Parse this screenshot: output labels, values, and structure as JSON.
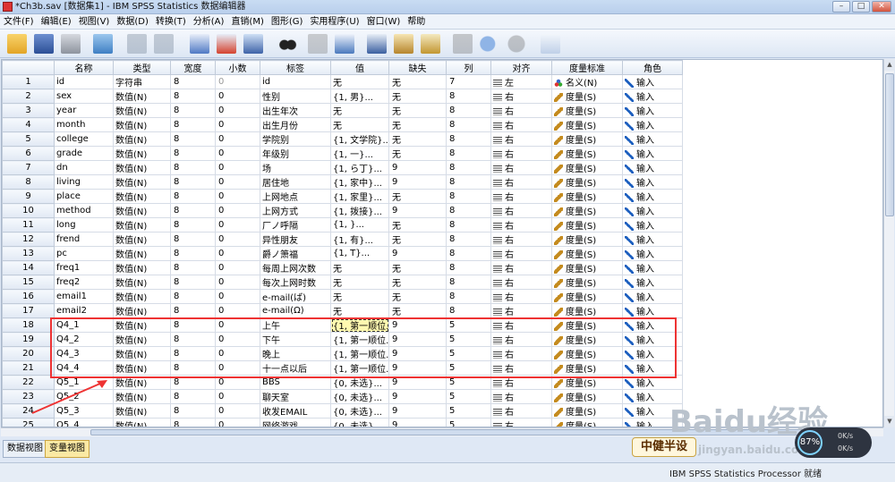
{
  "window": {
    "title": "*Ch3b.sav [数据集1] - IBM SPSS Statistics 数据编辑器"
  },
  "menu": [
    "文件(F)",
    "编辑(E)",
    "视图(V)",
    "数据(D)",
    "转换(T)",
    "分析(A)",
    "直销(M)",
    "图形(G)",
    "实用程序(U)",
    "窗口(W)",
    "帮助"
  ],
  "toolbar": [
    {
      "icon": "open-folder-icon"
    },
    {
      "icon": "save-icon"
    },
    {
      "icon": "print-icon"
    },
    {
      "icon": "dialog-recall-icon"
    },
    {
      "icon": "undo-icon"
    },
    {
      "icon": "redo-icon"
    },
    {
      "icon": "goto-case-icon"
    },
    {
      "icon": "goto-variable-icon"
    },
    {
      "icon": "variables-icon"
    },
    {
      "icon": "find-icon"
    },
    {
      "icon": "insert-cases-icon"
    },
    {
      "icon": "insert-variable-icon"
    },
    {
      "icon": "split-file-icon"
    },
    {
      "icon": "weight-cases-icon"
    },
    {
      "icon": "select-cases-icon"
    },
    {
      "icon": "value-labels-icon"
    },
    {
      "icon": "use-sets-icon"
    },
    {
      "icon": "show-all-variables-icon"
    },
    {
      "icon": "spell-check-icon"
    }
  ],
  "columns": [
    "名称",
    "类型",
    "宽度",
    "小数",
    "标签",
    "值",
    "缺失",
    "列",
    "对齐",
    "度量标准",
    "角色"
  ],
  "rows": [
    {
      "n": "1",
      "name": "id",
      "type": "字符串",
      "width": "8",
      "dec": "0",
      "label": "id",
      "values": "无",
      "missing": "无",
      "col": "7",
      "align": "左",
      "measure": "名义(N)",
      "role": "输入",
      "dim_dec": true,
      "nominal": true
    },
    {
      "n": "2",
      "name": "sex",
      "type": "数值(N)",
      "width": "8",
      "dec": "0",
      "label": "性别",
      "values": "{1, 男}...",
      "missing": "无",
      "col": "8",
      "align": "右",
      "measure": "度量(S)",
      "role": "输入"
    },
    {
      "n": "3",
      "name": "year",
      "type": "数值(N)",
      "width": "8",
      "dec": "0",
      "label": "出生年次",
      "values": "无",
      "missing": "无",
      "col": "8",
      "align": "右",
      "measure": "度量(S)",
      "role": "输入"
    },
    {
      "n": "4",
      "name": "month",
      "type": "数值(N)",
      "width": "8",
      "dec": "0",
      "label": "出生月份",
      "values": "无",
      "missing": "无",
      "col": "8",
      "align": "右",
      "measure": "度量(S)",
      "role": "输入"
    },
    {
      "n": "5",
      "name": "college",
      "type": "数值(N)",
      "width": "8",
      "dec": "0",
      "label": "学院别",
      "values": "{1, 文学院}...",
      "missing": "无",
      "col": "8",
      "align": "右",
      "measure": "度量(S)",
      "role": "输入"
    },
    {
      "n": "6",
      "name": "grade",
      "type": "数值(N)",
      "width": "8",
      "dec": "0",
      "label": "年级别",
      "values": "{1, 一}...",
      "missing": "无",
      "col": "8",
      "align": "右",
      "measure": "度量(S)",
      "role": "输入"
    },
    {
      "n": "7",
      "name": "dn",
      "type": "数值(N)",
      "width": "8",
      "dec": "0",
      "label": "场",
      "values": "{1, ら丁}...",
      "missing": "9",
      "col": "8",
      "align": "右",
      "measure": "度量(S)",
      "role": "输入"
    },
    {
      "n": "8",
      "name": "living",
      "type": "数值(N)",
      "width": "8",
      "dec": "0",
      "label": "居住地",
      "values": "{1, 家中}...",
      "missing": "9",
      "col": "8",
      "align": "右",
      "measure": "度量(S)",
      "role": "输入"
    },
    {
      "n": "9",
      "name": "place",
      "type": "数值(N)",
      "width": "8",
      "dec": "0",
      "label": "上网地点",
      "values": "{1, 家里}...",
      "missing": "无",
      "col": "8",
      "align": "右",
      "measure": "度量(S)",
      "role": "输入"
    },
    {
      "n": "10",
      "name": "method",
      "type": "数值(N)",
      "width": "8",
      "dec": "0",
      "label": "上网方式",
      "values": "{1, 拨接}...",
      "missing": "9",
      "col": "8",
      "align": "右",
      "measure": "度量(S)",
      "role": "输入"
    },
    {
      "n": "11",
      "name": "long",
      "type": "数值(N)",
      "width": "8",
      "dec": "0",
      "label": "厂ノ呼隔",
      "values": "{1, }...",
      "missing": "无",
      "col": "8",
      "align": "右",
      "measure": "度量(S)",
      "role": "输入"
    },
    {
      "n": "12",
      "name": "frend",
      "type": "数值(N)",
      "width": "8",
      "dec": "0",
      "label": "异性朋友",
      "values": "{1, 有}...",
      "missing": "无",
      "col": "8",
      "align": "右",
      "measure": "度量(S)",
      "role": "输入"
    },
    {
      "n": "13",
      "name": "pc",
      "type": "数值(N)",
      "width": "8",
      "dec": "0",
      "label": "爵ノ箫福",
      "values": "{1, T}...",
      "missing": "9",
      "col": "8",
      "align": "右",
      "measure": "度量(S)",
      "role": "输入"
    },
    {
      "n": "14",
      "name": "freq1",
      "type": "数值(N)",
      "width": "8",
      "dec": "0",
      "label": "每周上网次数",
      "values": "无",
      "missing": "无",
      "col": "8",
      "align": "右",
      "measure": "度量(S)",
      "role": "输入"
    },
    {
      "n": "15",
      "name": "freq2",
      "type": "数值(N)",
      "width": "8",
      "dec": "0",
      "label": "每次上网时数",
      "values": "无",
      "missing": "无",
      "col": "8",
      "align": "右",
      "measure": "度量(S)",
      "role": "输入"
    },
    {
      "n": "16",
      "name": "email1",
      "type": "数值(N)",
      "width": "8",
      "dec": "0",
      "label": "e-mail(ば)",
      "values": "无",
      "missing": "无",
      "col": "8",
      "align": "右",
      "measure": "度量(S)",
      "role": "输入"
    },
    {
      "n": "17",
      "name": "email2",
      "type": "数值(N)",
      "width": "8",
      "dec": "0",
      "label": "e-mail(Ω)",
      "values": "无",
      "missing": "无",
      "col": "8",
      "align": "右",
      "measure": "度量(S)",
      "role": "输入"
    },
    {
      "n": "18",
      "name": "Q4_1",
      "type": "数值(N)",
      "width": "8",
      "dec": "0",
      "label": "上午",
      "values": "{1, 第一顺位...",
      "missing": "9",
      "col": "5",
      "align": "右",
      "measure": "度量(S)",
      "role": "输入",
      "sel": true
    },
    {
      "n": "19",
      "name": "Q4_2",
      "type": "数值(N)",
      "width": "8",
      "dec": "0",
      "label": "下午",
      "values": "{1, 第一顺位...",
      "missing": "9",
      "col": "5",
      "align": "右",
      "measure": "度量(S)",
      "role": "输入"
    },
    {
      "n": "20",
      "name": "Q4_3",
      "type": "数值(N)",
      "width": "8",
      "dec": "0",
      "label": "晚上",
      "values": "{1, 第一顺位...",
      "missing": "9",
      "col": "5",
      "align": "右",
      "measure": "度量(S)",
      "role": "输入"
    },
    {
      "n": "21",
      "name": "Q4_4",
      "type": "数值(N)",
      "width": "8",
      "dec": "0",
      "label": "十一点以后",
      "values": "{1, 第一顺位...",
      "missing": "9",
      "col": "5",
      "align": "右",
      "measure": "度量(S)",
      "role": "输入"
    },
    {
      "n": "22",
      "name": "Q5_1",
      "type": "数值(N)",
      "width": "8",
      "dec": "0",
      "label": "BBS",
      "values": "{0, 未选}...",
      "missing": "9",
      "col": "5",
      "align": "右",
      "measure": "度量(S)",
      "role": "输入"
    },
    {
      "n": "23",
      "name": "Q5_2",
      "type": "数值(N)",
      "width": "8",
      "dec": "0",
      "label": "聊天室",
      "values": "{0, 未选}...",
      "missing": "9",
      "col": "5",
      "align": "右",
      "measure": "度量(S)",
      "role": "输入"
    },
    {
      "n": "24",
      "name": "Q5_3",
      "type": "数值(N)",
      "width": "8",
      "dec": "0",
      "label": "收发EMAIL",
      "values": "{0, 未选}...",
      "missing": "9",
      "col": "5",
      "align": "右",
      "measure": "度量(S)",
      "role": "输入"
    },
    {
      "n": "25",
      "name": "Q5_4",
      "type": "数值(N)",
      "width": "8",
      "dec": "0",
      "label": "网络游戏",
      "values": "{0, 未选}...",
      "missing": "9",
      "col": "5",
      "align": "右",
      "measure": "度量(S)",
      "role": "输入"
    }
  ],
  "tabs": {
    "data_view": "数据视图",
    "variable_view": "变量视图"
  },
  "status": {
    "message": "IBM SPSS Statistics Processor 就绪"
  },
  "overlay": {
    "badge": "中健半设",
    "watermark": "Baidu经验",
    "watermark_url": "jingyan.baidu.com",
    "net_percent": "87%",
    "net_up": "0K/s",
    "net_down": "0K/s"
  },
  "colors": {
    "annotation": "#e33333",
    "selected_cell": "#fff9b0",
    "active_tab": "#fbe9a4"
  }
}
